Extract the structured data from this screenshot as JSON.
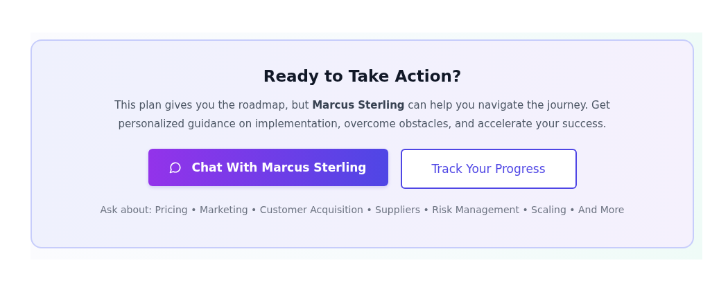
{
  "cta": {
    "title": "Ready to Take Action?",
    "description": "This plan gives you the roadmap, but **Marcus Sterling** can help you navigate the journey. Get personalized guidance on implementation, overcome obstacles, and accelerate your success.",
    "buttons": [
      {
        "kind": "primary",
        "label": "Chat With Marcus Sterling"
      },
      {
        "kind": "outline",
        "label": "Track Your Progress"
      }
    ],
    "topics": "Ask about: Pricing • Marketing • Customer Acquisition • Suppliers • Risk Management • Scaling • And More"
  }
}
